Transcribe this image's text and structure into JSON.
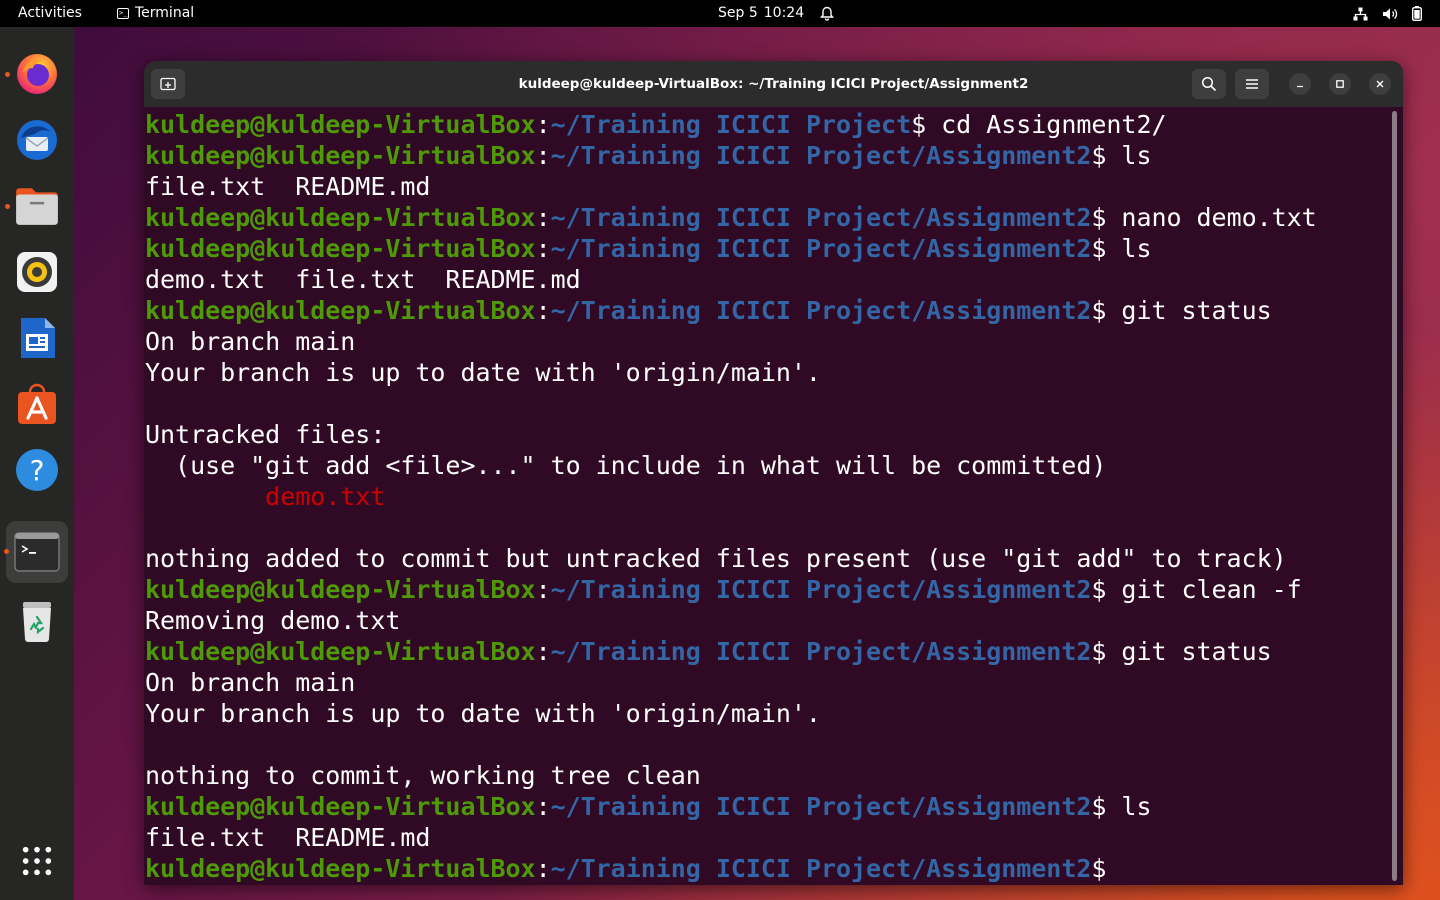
{
  "topbar": {
    "activities": "Activities",
    "app_name": "Terminal",
    "date": "Sep 5",
    "time": "10:24"
  },
  "dock": {
    "items": [
      {
        "name": "Firefox",
        "icon": "firefox-icon",
        "running": true
      },
      {
        "name": "Thunderbird",
        "icon": "thunderbird-icon",
        "running": false
      },
      {
        "name": "Files",
        "icon": "files-icon",
        "running": true
      },
      {
        "name": "Rhythmbox",
        "icon": "rhythmbox-icon",
        "running": false
      },
      {
        "name": "LibreOffice Writer",
        "icon": "writer-icon",
        "running": false
      },
      {
        "name": "Ubuntu Software",
        "icon": "software-icon",
        "running": false
      },
      {
        "name": "Help",
        "icon": "help-icon",
        "running": false
      },
      {
        "name": "Terminal",
        "icon": "terminal-icon",
        "running": true
      },
      {
        "name": "Trash",
        "icon": "trash-icon",
        "running": false
      },
      {
        "name": "Show Applications",
        "icon": "app-grid-icon",
        "running": false
      }
    ]
  },
  "window": {
    "title": "kuldeep@kuldeep-VirtualBox: ~/Training ICICI Project/Assignment2"
  },
  "colors": {
    "terminal_bg": "#300a24",
    "prompt_user": "#4e9a06",
    "prompt_path": "#3465a4",
    "untracked": "#cc0000",
    "accent": "#e95420"
  },
  "terminal": {
    "user": "kuldeep@kuldeep-VirtualBox",
    "lines": [
      {
        "type": "prompt",
        "path": "~/Training ICICI Project",
        "cmd": " cd Assignment2/"
      },
      {
        "type": "prompt",
        "path": "~/Training ICICI Project/Assignment2",
        "cmd": " ls"
      },
      {
        "type": "out",
        "text": "file.txt  README.md"
      },
      {
        "type": "prompt",
        "path": "~/Training ICICI Project/Assignment2",
        "cmd": " nano demo.txt"
      },
      {
        "type": "prompt",
        "path": "~/Training ICICI Project/Assignment2",
        "cmd": " ls"
      },
      {
        "type": "out",
        "text": "demo.txt  file.txt  README.md"
      },
      {
        "type": "prompt",
        "path": "~/Training ICICI Project/Assignment2",
        "cmd": " git status"
      },
      {
        "type": "out",
        "text": "On branch main"
      },
      {
        "type": "out",
        "text": "Your branch is up to date with 'origin/main'."
      },
      {
        "type": "out",
        "text": ""
      },
      {
        "type": "out",
        "text": "Untracked files:"
      },
      {
        "type": "out",
        "text": "  (use \"git add <file>...\" to include in what will be committed)"
      },
      {
        "type": "red",
        "text": "        demo.txt"
      },
      {
        "type": "out",
        "text": ""
      },
      {
        "type": "out",
        "text": "nothing added to commit but untracked files present (use \"git add\" to track)"
      },
      {
        "type": "prompt",
        "path": "~/Training ICICI Project/Assignment2",
        "cmd": " git clean -f"
      },
      {
        "type": "out",
        "text": "Removing demo.txt"
      },
      {
        "type": "prompt",
        "path": "~/Training ICICI Project/Assignment2",
        "cmd": " git status"
      },
      {
        "type": "out",
        "text": "On branch main"
      },
      {
        "type": "out",
        "text": "Your branch is up to date with 'origin/main'."
      },
      {
        "type": "out",
        "text": ""
      },
      {
        "type": "out",
        "text": "nothing to commit, working tree clean"
      },
      {
        "type": "prompt",
        "path": "~/Training ICICI Project/Assignment2",
        "cmd": " ls"
      },
      {
        "type": "out",
        "text": "file.txt  README.md"
      },
      {
        "type": "prompt",
        "path": "~/Training ICICI Project/Assignment2",
        "cmd": ""
      }
    ]
  }
}
